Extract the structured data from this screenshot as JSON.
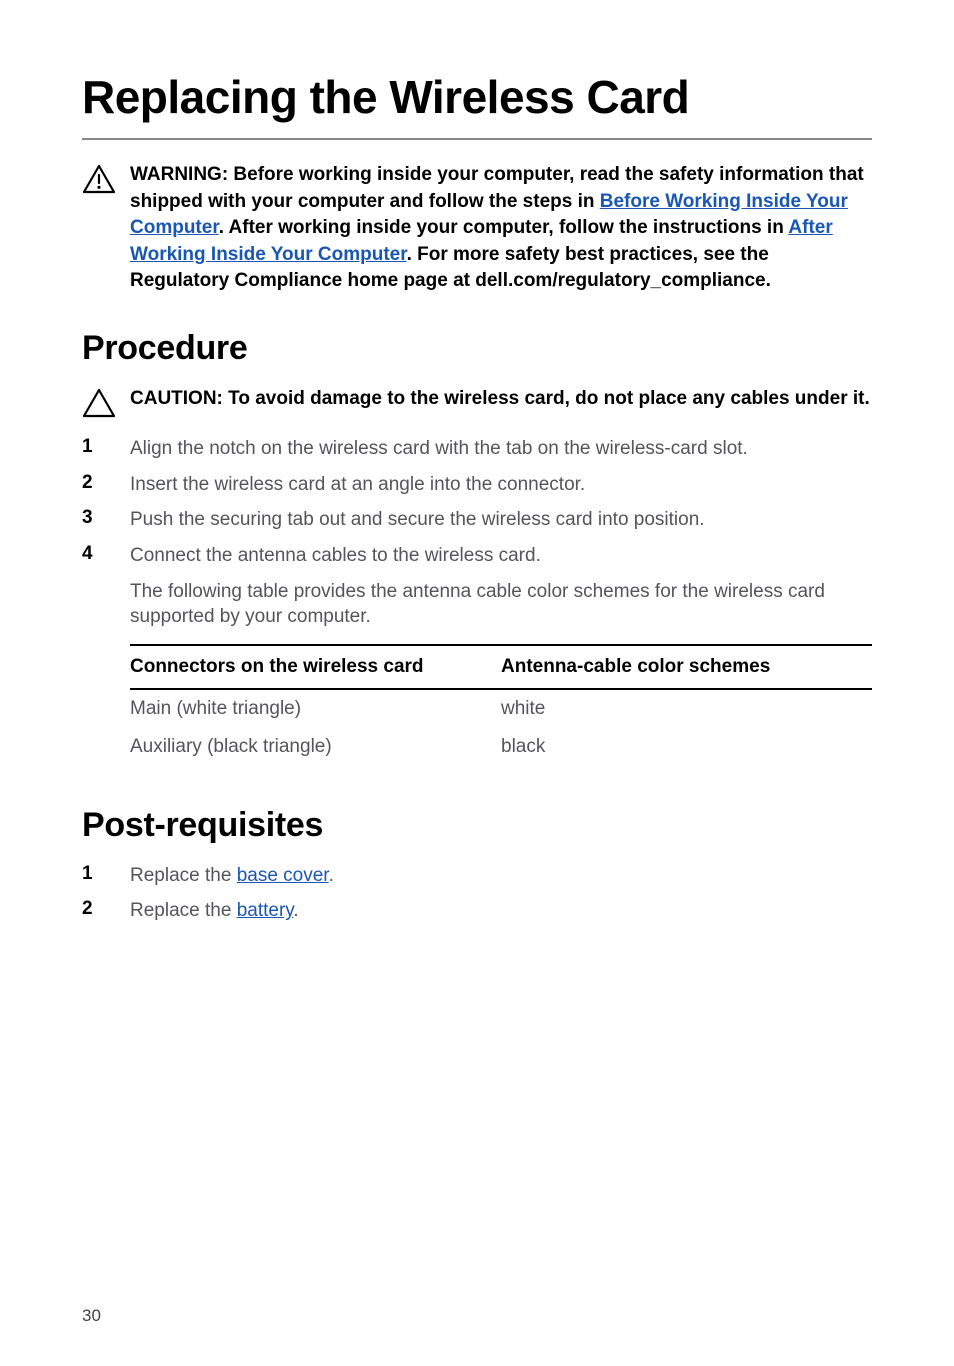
{
  "title": "Replacing the Wireless Card",
  "warning": {
    "prefix": "WARNING: Before working inside your computer, read the safety information that shipped with your computer and follow the steps in ",
    "link1": "Before Working Inside Your Computer",
    "mid1": ". After working inside your computer, follow the instructions in ",
    "link2": "After Working Inside Your Computer",
    "tail": ". For more safety best practices, see the Regulatory Compliance home page at dell.com/regulatory_compliance."
  },
  "procedure": {
    "heading": "Procedure",
    "caution": "CAUTION: To avoid damage to the wireless card, do not place any cables under it.",
    "steps": [
      "Align the notch on the wireless card with the tab on the wireless-card slot.",
      "Insert the wireless card at an angle into the connector.",
      "Push the securing tab out and secure the wireless card into position.",
      "Connect the antenna cables to the wireless card."
    ],
    "step4_followup": "The following table provides the antenna cable color schemes for the wireless card supported by your computer.",
    "table": {
      "h1": "Connectors on the wireless card",
      "h2": "Antenna-cable color schemes",
      "rows": [
        {
          "c1": "Main (white triangle)",
          "c2": "white"
        },
        {
          "c1": "Auxiliary (black triangle)",
          "c2": "black"
        }
      ]
    }
  },
  "postreq": {
    "heading": "Post-requisites",
    "steps": [
      {
        "prefix": "Replace the ",
        "link": "base cover",
        "suffix": "."
      },
      {
        "prefix": "Replace the ",
        "link": "battery",
        "suffix": "."
      }
    ]
  },
  "page_number": "30"
}
